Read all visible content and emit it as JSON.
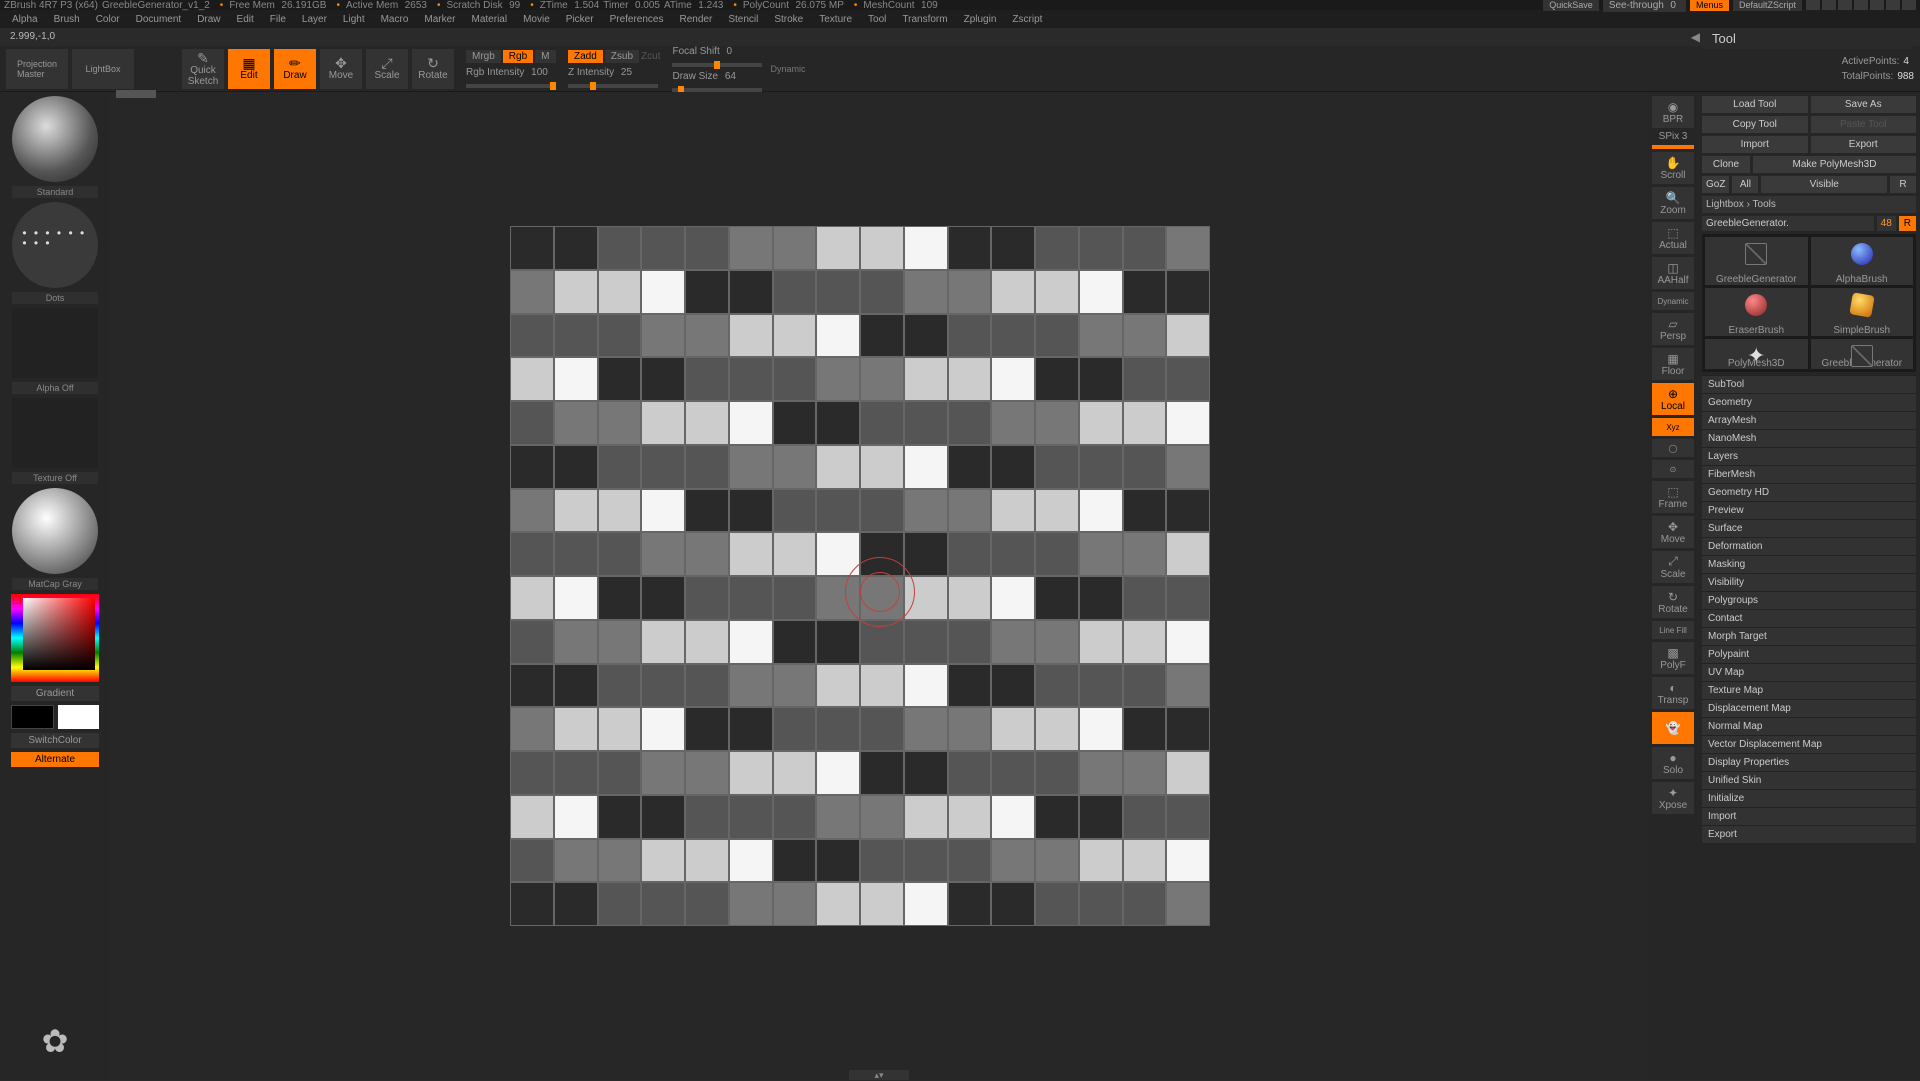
{
  "titlebar": {
    "app": "ZBrush 4R7 P3 (x64)",
    "doc": "GreebleGenerator_v1_2",
    "freemem_lbl": "Free Mem",
    "freemem": "26.191GB",
    "actmem_lbl": "Active Mem",
    "actmem": "2653",
    "scratch_lbl": "Scratch Disk",
    "scratch": "99",
    "ztime_lbl": "ZTime",
    "ztime": "1.504",
    "timer_lbl": "Timer",
    "timer": "0.005",
    "atime_lbl": "ATime",
    "atime": "1.243",
    "poly_lbl": "PolyCount",
    "poly": "26.075 MP",
    "mesh_lbl": "MeshCount",
    "mesh": "109",
    "quicksave": "QuickSave",
    "seethru": "See-through",
    "seethru_v": "0",
    "menus": "Menus",
    "script": "DefaultZScript"
  },
  "menus": [
    "Alpha",
    "Brush",
    "Color",
    "Document",
    "Draw",
    "Edit",
    "File",
    "Layer",
    "Light",
    "Macro",
    "Marker",
    "Material",
    "Movie",
    "Picker",
    "Preferences",
    "Render",
    "Stencil",
    "Stroke",
    "Texture",
    "Tool",
    "Transform",
    "Zplugin",
    "Zscript"
  ],
  "status_coords": "2.999,-1,0",
  "panel_title": "Tool",
  "toolbar": {
    "proj_master": "Projection\nMaster",
    "lightbox": "LightBox",
    "quick_sketch": "Quick\nSketch",
    "edit": "Edit",
    "draw": "Draw",
    "move": "Move",
    "scale": "Scale",
    "rotate": "Rotate",
    "mrgb": "Mrgb",
    "rgb": "Rgb",
    "m": "M",
    "rgb_int_lbl": "Rgb Intensity",
    "rgb_int": "100",
    "zadd": "Zadd",
    "zsub": "Zsub",
    "zcut": "Zcut",
    "z_int_lbl": "Z Intensity",
    "z_int": "25",
    "focal_lbl": "Focal Shift",
    "focal": "0",
    "draw_size_lbl": "Draw Size",
    "draw_size": "64",
    "dynamic": "Dynamic",
    "active_pts_lbl": "ActivePoints:",
    "active_pts": "4",
    "total_pts_lbl": "TotalPoints:",
    "total_pts": "988"
  },
  "left": {
    "brush": "Standard",
    "stroke": "Dots",
    "alpha": "Alpha Off",
    "texture": "Texture Off",
    "material": "MatCap Gray",
    "gradient": "Gradient",
    "switchcolor": "SwitchColor",
    "alternate": "Alternate"
  },
  "midrail": {
    "bpr": "BPR",
    "spix_lbl": "SPix",
    "spix": "3",
    "scroll": "Scroll",
    "zoom": "Zoom",
    "actual": "Actual",
    "aahalf": "AAHalf",
    "dynamic": "Dynamic",
    "persp": "Persp",
    "floor": "Floor",
    "local": "Local",
    "xyz": "Xyz",
    "frame": "Frame",
    "move": "Move",
    "scale": "Scale",
    "rotate": "Rotate",
    "linefill": "Line Fill",
    "polyf": "PolyF",
    "transp": "Transp",
    "ghost": "Ghost",
    "solo": "Solo",
    "xpose": "Xpose"
  },
  "right": {
    "load": "Load Tool",
    "save": "Save As",
    "copy": "Copy Tool",
    "paste": "Paste Tool",
    "import": "Import",
    "export": "Export",
    "clone": "Clone",
    "makepm": "Make PolyMesh3D",
    "goz": "GoZ",
    "all": "All",
    "visible": "Visible",
    "r": "R",
    "lightbox_tools": "Lightbox › Tools",
    "tool_name": "GreebleGenerator.",
    "tool_count": "48",
    "tools": {
      "t0": "GreebleGenerator",
      "t1": "AlphaBrush",
      "t2": "EraserBrush",
      "t3": "SimpleBrush",
      "t4": "PolyMesh3D",
      "t5": "GreebleGenerator"
    },
    "sections": [
      "SubTool",
      "Geometry",
      "ArrayMesh",
      "NanoMesh",
      "Layers",
      "FiberMesh",
      "Geometry HD",
      "Preview",
      "Surface",
      "Deformation",
      "Masking",
      "Visibility",
      "Polygroups",
      "Contact",
      "Morph Target",
      "Polypaint",
      "UV Map",
      "Texture Map",
      "Displacement Map",
      "Normal Map",
      "Vector Displacement Map",
      "Display Properties",
      "Unified Skin",
      "Initialize",
      "Import",
      "Export"
    ]
  }
}
